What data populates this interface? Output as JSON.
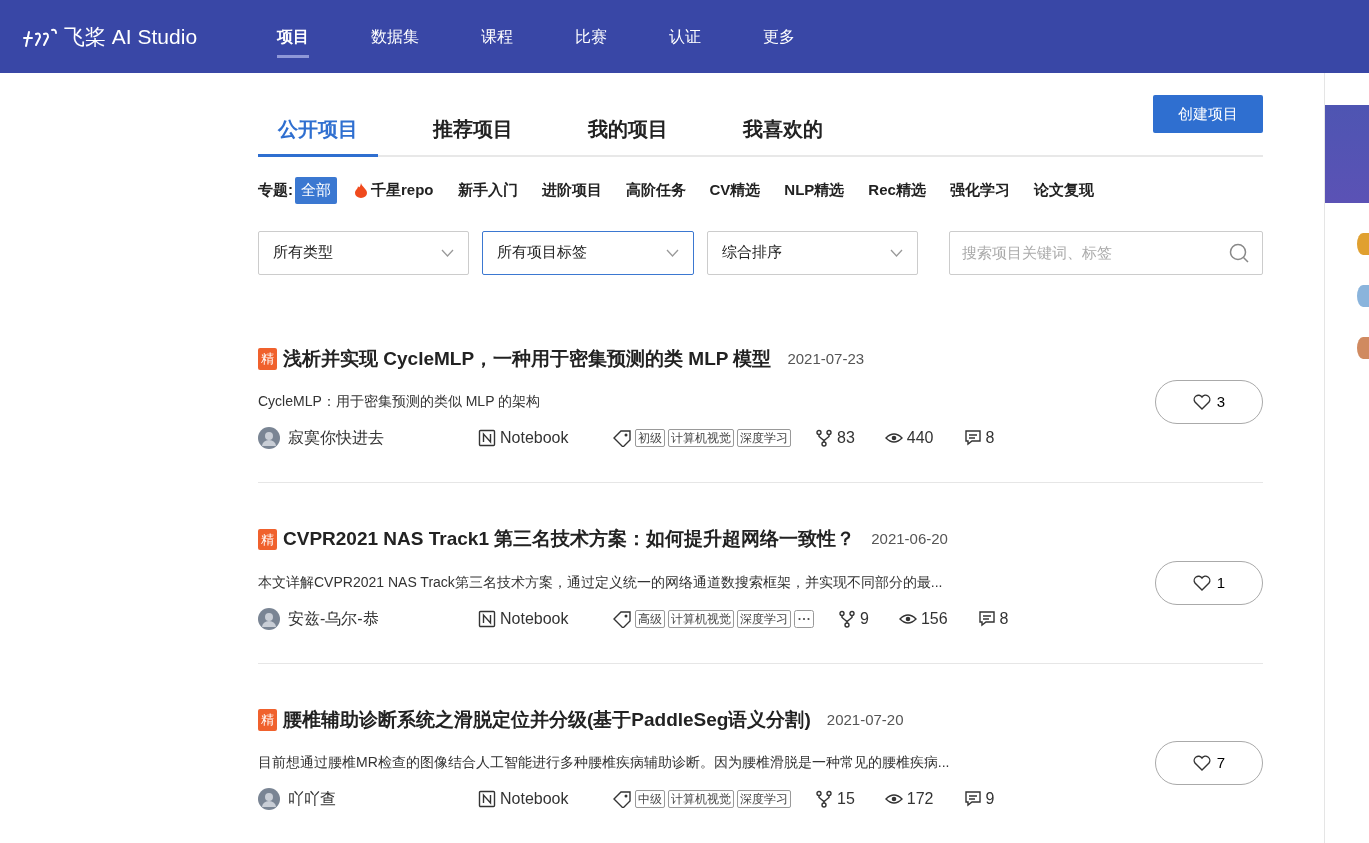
{
  "header": {
    "logo_text": "飞桨 AI Studio",
    "nav": [
      {
        "label": "项目",
        "selected": true
      },
      {
        "label": "数据集",
        "selected": false
      },
      {
        "label": "课程",
        "selected": false
      },
      {
        "label": "比赛",
        "selected": false
      },
      {
        "label": "认证",
        "selected": false
      },
      {
        "label": "更多",
        "selected": false
      }
    ]
  },
  "tabs": [
    {
      "label": "公开项目",
      "selected": true
    },
    {
      "label": "推荐项目",
      "selected": false
    },
    {
      "label": "我的项目",
      "selected": false
    },
    {
      "label": "我喜欢的",
      "selected": false
    }
  ],
  "create_button": "创建项目",
  "topics": {
    "label": "专题:",
    "items": [
      {
        "label": "全部",
        "selected": true,
        "hot": false
      },
      {
        "label": "千星repo",
        "selected": false,
        "hot": true
      },
      {
        "label": "新手入门",
        "selected": false,
        "hot": false
      },
      {
        "label": "进阶项目",
        "selected": false,
        "hot": false
      },
      {
        "label": "高阶任务",
        "selected": false,
        "hot": false
      },
      {
        "label": "CV精选",
        "selected": false,
        "hot": false
      },
      {
        "label": "NLP精选",
        "selected": false,
        "hot": false
      },
      {
        "label": "Rec精选",
        "selected": false,
        "hot": false
      },
      {
        "label": "强化学习",
        "selected": false,
        "hot": false
      },
      {
        "label": "论文复现",
        "selected": false,
        "hot": false
      }
    ]
  },
  "filters": [
    {
      "value": "所有类型",
      "focused": false
    },
    {
      "value": "所有项目标签",
      "focused": true
    },
    {
      "value": "综合排序",
      "focused": false
    }
  ],
  "search": {
    "placeholder": "搜索项目关键词、标签"
  },
  "projects": [
    {
      "badge": "精",
      "title": "浅析并实现 CycleMLP，一种用于密集预测的类 MLP 模型",
      "date": "2021-07-23",
      "description": "CycleMLP：用于密集预测的类似 MLP 的架构",
      "author": "寂寞你快进去",
      "type": "Notebook",
      "tags": [
        "初级",
        "计算机视觉",
        "深度学习"
      ],
      "more_tags": false,
      "forks": "83",
      "views": "440",
      "comments": "8",
      "likes": "3"
    },
    {
      "badge": "精",
      "title": "CVPR2021 NAS Track1 第三名技术方案：如何提升超网络一致性？",
      "date": "2021-06-20",
      "description": "本文详解CVPR2021 NAS Track第三名技术方案，通过定义统一的网络通道数搜索框架，并实现不同部分的最...",
      "author": "安兹-乌尔-恭",
      "type": "Notebook",
      "tags": [
        "高级",
        "计算机视觉",
        "深度学习"
      ],
      "more_tags": true,
      "forks": "9",
      "views": "156",
      "comments": "8",
      "likes": "1"
    },
    {
      "badge": "精",
      "title": "腰椎辅助诊断系统之滑脱定位并分级(基于PaddleSeg语义分割)",
      "date": "2021-07-20",
      "description": "目前想通过腰椎MR检查的图像结合人工智能进行多种腰椎疾病辅助诊断。因为腰椎滑脱是一种常见的腰椎疾病...",
      "author": "吖吖查",
      "type": "Notebook",
      "tags": [
        "中级",
        "计算机视觉",
        "深度学习"
      ],
      "more_tags": false,
      "forks": "15",
      "views": "172",
      "comments": "9",
      "likes": "7"
    }
  ],
  "side_panel": {
    "medals": [
      {
        "color": "#e0a030"
      },
      {
        "color": "#8ab4dc"
      },
      {
        "color": "#d08a60"
      }
    ]
  }
}
